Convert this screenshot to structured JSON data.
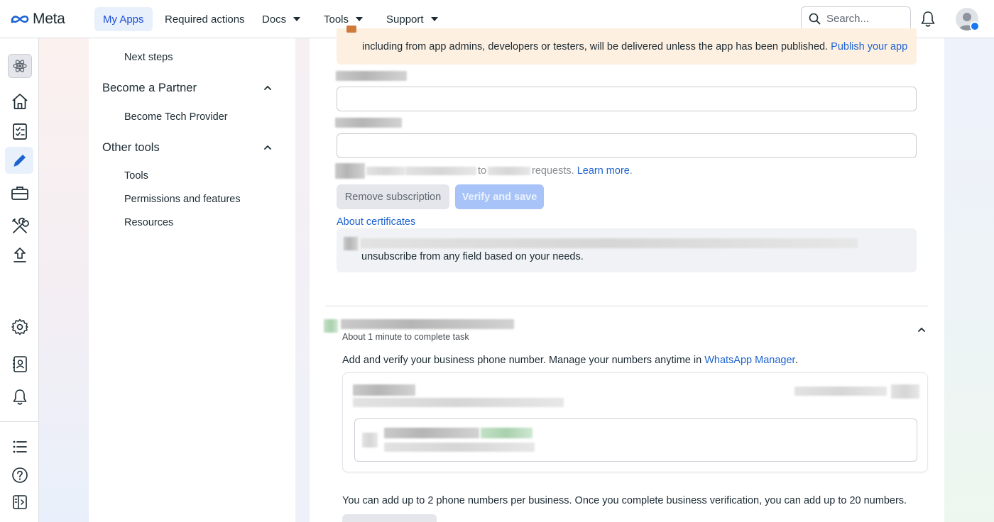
{
  "topbar": {
    "logo_text": "Meta",
    "nav": [
      {
        "label": "My Apps",
        "active": true,
        "has_dropdown": false
      },
      {
        "label": "Required actions",
        "active": false,
        "has_dropdown": false
      },
      {
        "label": "Docs",
        "active": false,
        "has_dropdown": true
      },
      {
        "label": "Tools",
        "active": false,
        "has_dropdown": true
      },
      {
        "label": "Support",
        "active": false,
        "has_dropdown": true
      }
    ],
    "search_placeholder": "Search...",
    "icons": [
      "search-icon",
      "bell-icon",
      "avatar",
      "facebook-badge-icon"
    ]
  },
  "rail": {
    "icons": [
      "app-icon",
      "home-icon",
      "checklist-icon",
      "pencil-icon",
      "briefcase-icon",
      "tools-icon",
      "upload-icon",
      "gear-icon",
      "contact-book-icon",
      "bell-icon",
      "list-icon",
      "help-icon",
      "panel-toggle-icon"
    ],
    "active": "pencil-icon"
  },
  "sidebar": {
    "items": [
      {
        "label": "Next steps",
        "level": "sub"
      },
      {
        "label": "Become a Partner",
        "level": "head",
        "expanded": true
      },
      {
        "label": "Become Tech Provider",
        "level": "sub"
      },
      {
        "label": "Other tools",
        "level": "head",
        "expanded": true
      },
      {
        "label": "Tools",
        "level": "sub"
      },
      {
        "label": "Permissions and features",
        "level": "sub"
      },
      {
        "label": "Resources",
        "level": "sub"
      }
    ]
  },
  "main": {
    "warning": {
      "text": "including from app admins, developers or testers, will be delivered unless the app has been published.",
      "link": "Publish your app"
    },
    "requests_line": {
      "connector": "to",
      "suffix": "requests.",
      "link": "Learn more",
      "end": "."
    },
    "buttons": {
      "remove": "Remove subscription",
      "verify": "Verify and save"
    },
    "about_certificates": "About certificates",
    "info_text": "unsubscribe from any field based on your needs.",
    "task": {
      "subtitle": "About 1 minute to complete task",
      "add_text": "Add and verify your business phone number. Manage your numbers anytime in",
      "add_link": "WhatsApp Manager",
      "add_end": ".",
      "limit_text": "You can add up to 2 phone numbers per business. Once you complete business verification, you can add up to 20 numbers."
    }
  },
  "colors": {
    "accent": "#1d63d0",
    "active_bg": "#e7f0fb",
    "warning_bg": "#fdf0e1",
    "verify_btn": "#a7c3f7"
  }
}
